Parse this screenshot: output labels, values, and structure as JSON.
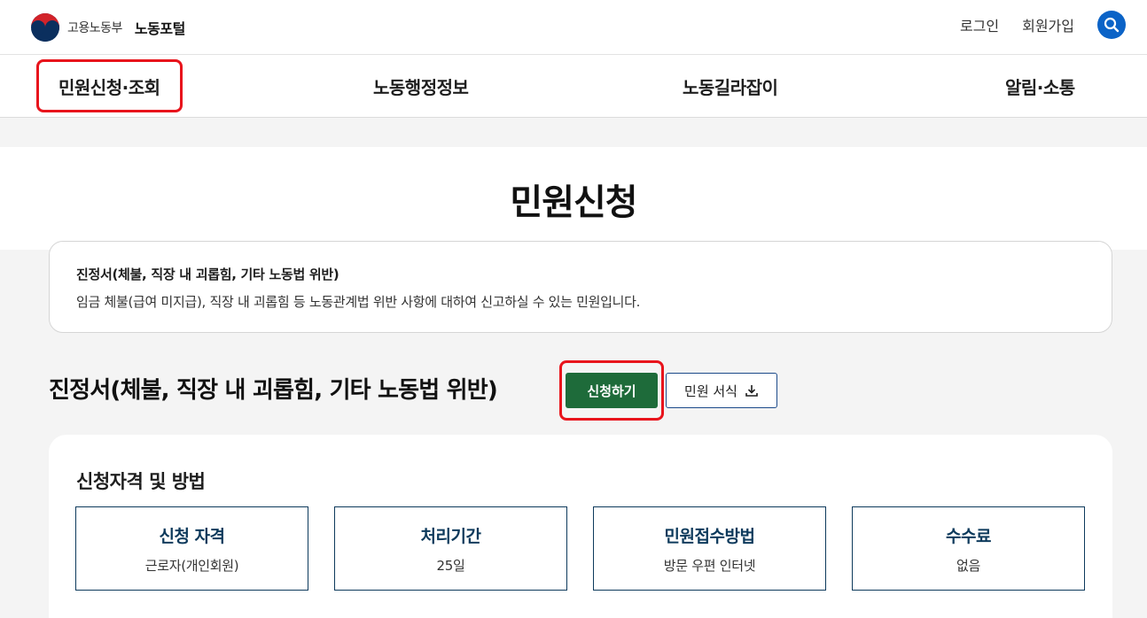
{
  "header": {
    "ministry": "고용노동부",
    "portal": "노동포털",
    "login": "로그인",
    "signup": "회원가입",
    "search_icon": "search-icon"
  },
  "nav": {
    "items": [
      {
        "label": "민원신청·조회",
        "active": true
      },
      {
        "label": "노동행정정보",
        "active": false
      },
      {
        "label": "노동길라잡이",
        "active": false
      },
      {
        "label": "알림·소통",
        "active": false
      }
    ]
  },
  "page": {
    "title": "민원신청"
  },
  "summary": {
    "title": "진정서(체불, 직장 내 괴롭힘, 기타 노동법 위반)",
    "description": "임금 체불(급여 미지급), 직장 내 괴롭힘 등 노동관계법 위반 사항에 대하여 신고하실 수 있는 민원입니다."
  },
  "section": {
    "title": "진정서(체불, 직장 내 괴롭힘, 기타 노동법 위반)",
    "apply_label": "신청하기",
    "form_label": "민원 서식",
    "download_icon": "download-icon"
  },
  "qualification": {
    "title": "신청자격 및 방법",
    "items": [
      {
        "label": "신청 자격",
        "value": "근로자(개인회원)"
      },
      {
        "label": "처리기간",
        "value": "25일"
      },
      {
        "label": "민원접수방법",
        "value": "방문 우편 인터넷"
      },
      {
        "label": "수수료",
        "value": "없음"
      }
    ]
  },
  "colors": {
    "highlight": "#e8141c",
    "apply_button": "#1e6b3a",
    "info_border": "#0d3a5c",
    "search_button": "#0b63c7"
  }
}
